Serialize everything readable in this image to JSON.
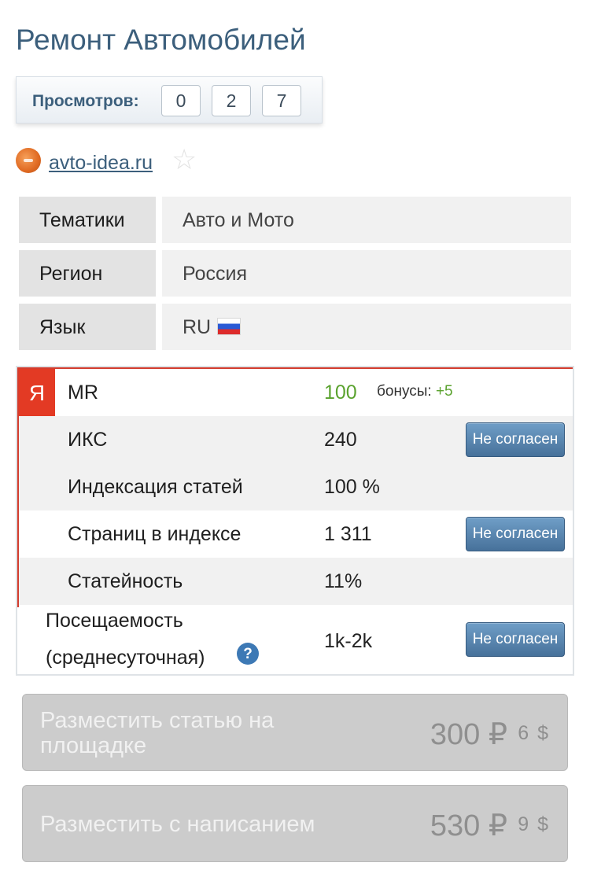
{
  "page": {
    "title": "Ремонт Автомобилей"
  },
  "views": {
    "label": "Просмотров:",
    "digits": [
      "0",
      "2",
      "7"
    ]
  },
  "site": {
    "link": "avto-idea.ru",
    "favorite_icon": "star-icon"
  },
  "info": [
    {
      "key": "Тематики",
      "value": "Авто и Мото"
    },
    {
      "key": "Регион",
      "value": "Россия"
    },
    {
      "key": "Язык",
      "value": "RU"
    }
  ],
  "stats": {
    "yandex_badge": "Я",
    "bonus_label": "бонусы:",
    "bonus_value": "+5",
    "disagree_label": "Не согласен",
    "help_icon": "?",
    "rows": [
      {
        "label": "MR",
        "value": "100"
      },
      {
        "label": "ИКС",
        "value": "240"
      },
      {
        "label": "Индексация статей",
        "value": "100 %"
      },
      {
        "label": "Страниц в индексе",
        "value": "1 311"
      },
      {
        "label": "Статейность",
        "value": "11%"
      },
      {
        "label_line1": "Посещаемость",
        "label_line2": "(среднесуточная)",
        "value": "1k-2k"
      }
    ]
  },
  "actions": [
    {
      "label": "Разместить статью на площадке",
      "price_rub": "300 ₽",
      "price_usd": "6 $"
    },
    {
      "label": "Разместить с написанием",
      "price_rub": "530 ₽",
      "price_usd": "9 $"
    }
  ],
  "colors": {
    "title": "#3c5f7c",
    "accent_green": "#5aa22e",
    "yandex_red": "#e33a24",
    "button_blue": "#47719a"
  }
}
